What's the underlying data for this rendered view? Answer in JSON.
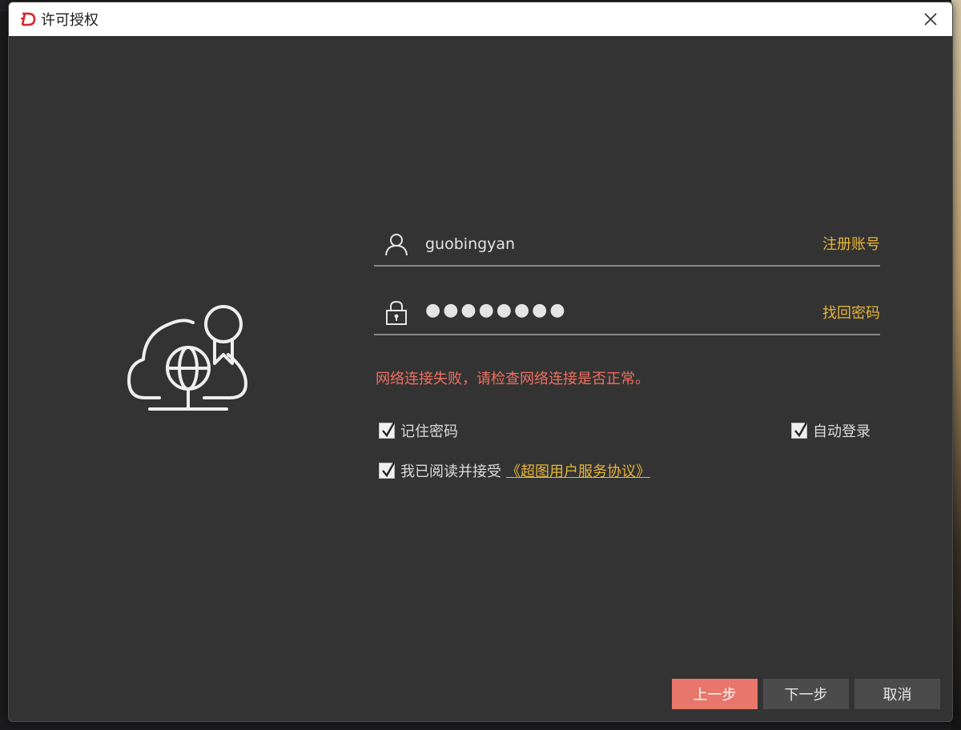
{
  "window": {
    "title": "许可授权"
  },
  "login": {
    "username": "guobingyan",
    "password_mask": "●●●●●●●●",
    "register_link": "注册账号",
    "recover_link": "找回密码",
    "error_message": "网络连接失败，请检查网络连接是否正常。"
  },
  "options": {
    "remember_password": {
      "label": "记住密码",
      "checked": true
    },
    "auto_login": {
      "label": "自动登录",
      "checked": true
    },
    "agree": {
      "label": "我已阅读并接受",
      "link": "《超图用户服务协议》",
      "checked": true
    }
  },
  "buttons": {
    "prev": "上一步",
    "next": "下一步",
    "cancel": "取消"
  },
  "icons": {
    "app_logo": "supermap-logo",
    "close": "close-icon",
    "illustration": "cloud-license-icon",
    "user": "user-icon",
    "lock": "lock-icon"
  },
  "colors": {
    "accent": "#e6b43c",
    "error": "#ee6f5f",
    "primary_button": "#e8766a",
    "dialog_bg": "#333333"
  }
}
